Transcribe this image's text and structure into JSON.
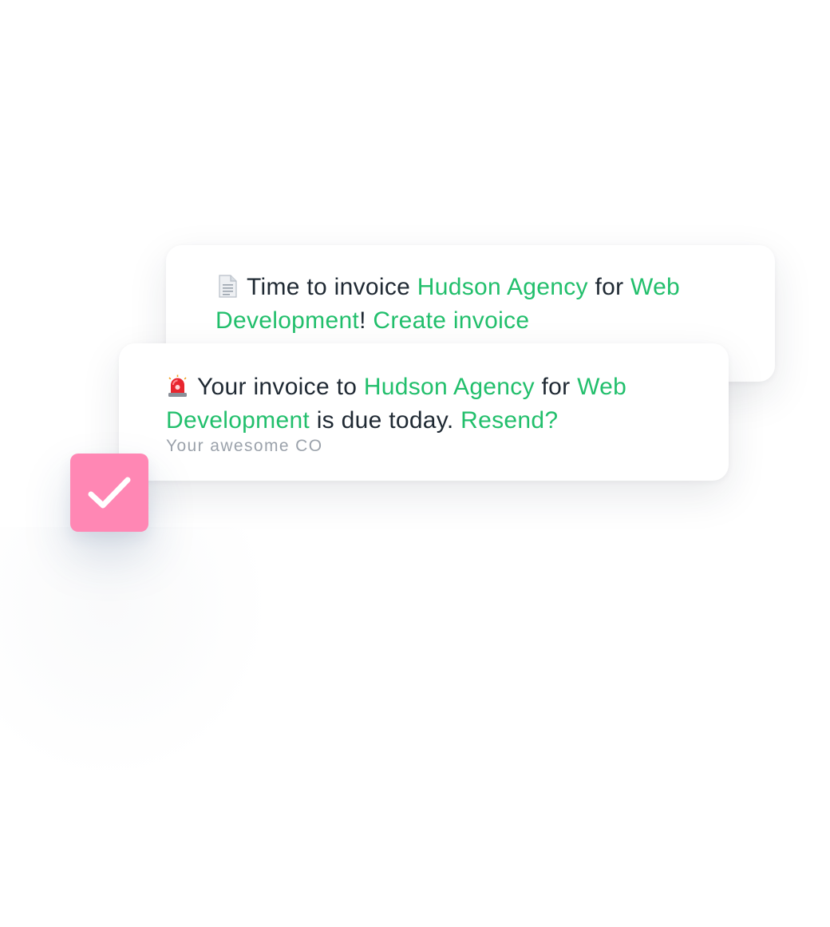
{
  "notifications": [
    {
      "icon": "document-icon",
      "parts": {
        "t1": "Time to invoice ",
        "client": "Hudson Agency",
        "t2": " for ",
        "project": "Web Development",
        "t3": "! ",
        "action": "Create invoice"
      }
    },
    {
      "icon": "siren-icon",
      "parts": {
        "t1": "Your invoice to ",
        "client": "Hudson Agency",
        "t2": " for ",
        "project": "Web Development",
        "t3": " is due today. ",
        "action": "Resend?"
      },
      "sender": "Your awesome CO"
    }
  ],
  "badge": {
    "icon": "checkmark-icon"
  },
  "colors": {
    "accent": "#22bf6c",
    "badge": "#ff87b4",
    "text": "#1f2933",
    "muted": "#9ba2ab"
  }
}
